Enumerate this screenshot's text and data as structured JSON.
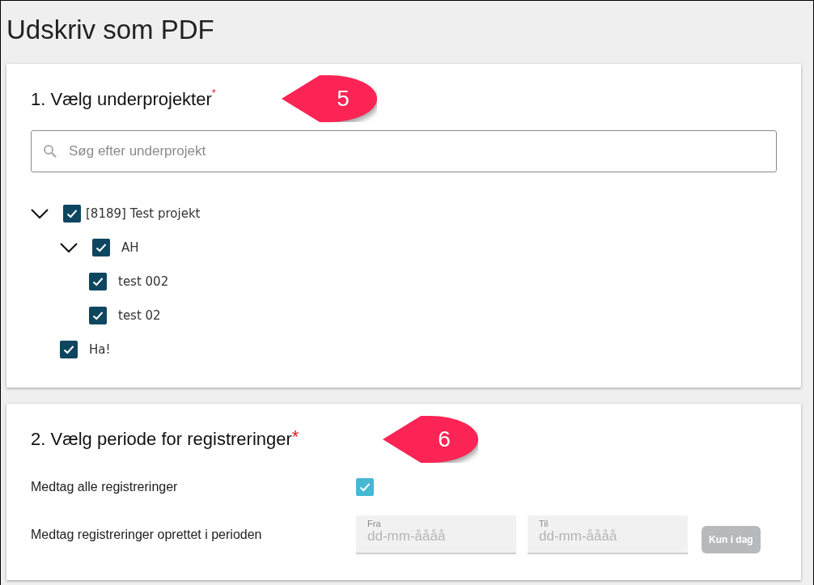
{
  "page": {
    "title": "Udskriv som PDF"
  },
  "sections": [
    {
      "heading": "1. Vælg underprojekter",
      "required_mark": "*",
      "callout": "5",
      "search": {
        "placeholder": "Søg efter underprojekt"
      },
      "tree": [
        {
          "label": "[8189] Test projekt",
          "checked": true,
          "expanded": true,
          "children": [
            {
              "label": "AH",
              "checked": true,
              "expanded": true,
              "children": [
                {
                  "label": "test 002",
                  "checked": true
                },
                {
                  "label": "test 02",
                  "checked": true
                }
              ]
            },
            {
              "label": "Ha!",
              "checked": true
            }
          ]
        }
      ]
    },
    {
      "heading": "2. Vælg periode for registreringer",
      "required_mark": "*",
      "callout": "6",
      "options": [
        {
          "kind": "checkbox",
          "label": "Medtag alle registreringer",
          "checked": true
        },
        {
          "kind": "period",
          "label": "Medtag registreringer oprettet i perioden",
          "disabled": true,
          "fields": [
            {
              "label": "Fra",
              "placeholder": "dd-mm-åååå"
            },
            {
              "label": "Til",
              "placeholder": "dd-mm-åååå"
            }
          ],
          "button": "Kun i dag"
        }
      ]
    }
  ]
}
